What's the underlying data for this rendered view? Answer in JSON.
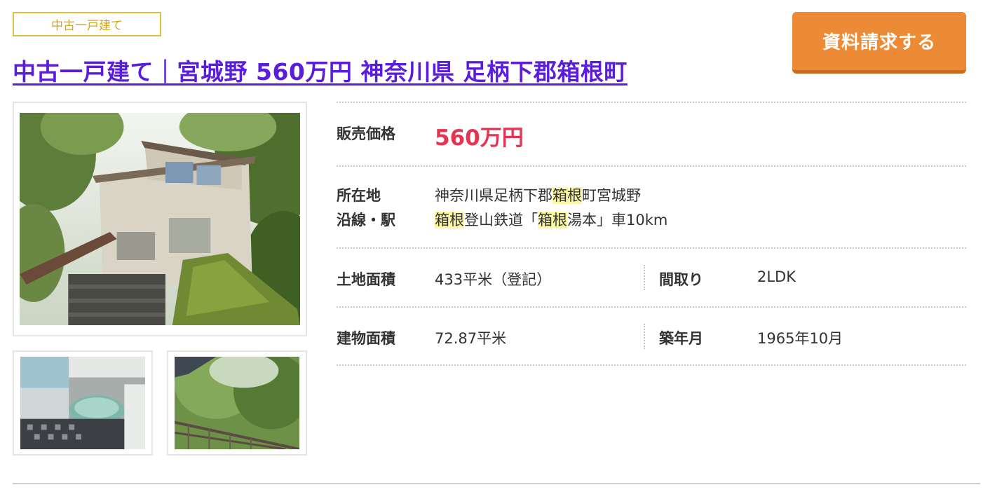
{
  "listing": {
    "type_badge": "中古一戸建て",
    "title": "中古一戸建て｜宮城野 560万円 神奈川県 足柄下郡箱根町",
    "request_button": "資料請求する"
  },
  "details": {
    "price_label": "販売価格",
    "price_value": "560万円",
    "location_label": "所在地",
    "location_parts": [
      "神奈川県足柄下郡",
      "箱根",
      "町宮城野"
    ],
    "line_label": "沿線・駅",
    "line_parts": [
      "箱根",
      "登山鉄道「",
      "箱根",
      "湯本」車10km"
    ],
    "land_area_label": "土地面積",
    "land_area_value": "433平米（登記）",
    "layout_label": "間取り",
    "layout_value": "2LDK",
    "building_area_label": "建物面積",
    "building_area_value": "72.87平米",
    "built_label": "築年月",
    "built_value": "1965年10月"
  },
  "colors": {
    "title": "#5a1ddc",
    "badge": "#e2be3c",
    "button": "#ec8a36",
    "price": "#e53553",
    "highlight": "#fbf7a5"
  }
}
